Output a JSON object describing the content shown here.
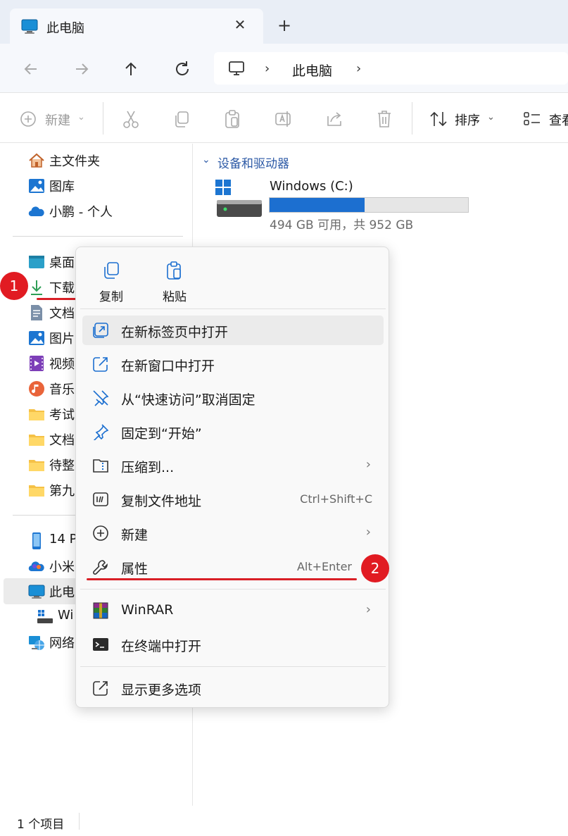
{
  "tab": {
    "title": "此电脑",
    "close_icon": "close-icon",
    "new_tab": "+"
  },
  "address": {
    "location": "此电脑"
  },
  "toolbar": {
    "new_label": "新建",
    "sort_label": "排序",
    "view_label": "查看"
  },
  "sidebar": {
    "home": "主文件夹",
    "gallery": "图库",
    "onedrive": "小鹏 - 个人",
    "desktop": "桌面",
    "downloads": "下载",
    "documents": "文档",
    "pictures": "图片",
    "videos": "视频",
    "music": "音乐",
    "folder1": "考试",
    "folder2": "文档",
    "folder3": "待整",
    "folder4": "第九",
    "phone": "14 P",
    "cloud": "小米",
    "thispc": "此电",
    "windrive": "Wi",
    "network": "网络"
  },
  "content": {
    "section": "设备和驱动器",
    "drive_name": "Windows (C:)",
    "drive_free": "494 GB 可用，共 952 GB",
    "drive_used_fraction": 0.48
  },
  "status": {
    "items": "1 个项目"
  },
  "context_menu": {
    "copy": "复制",
    "paste": "粘贴",
    "items": [
      {
        "label": "在新标签页中打开",
        "shortcut": ""
      },
      {
        "label": "在新窗口中打开",
        "shortcut": ""
      },
      {
        "label": "从“快速访问”取消固定",
        "shortcut": ""
      },
      {
        "label": "固定到“开始”",
        "shortcut": ""
      },
      {
        "label": "压缩到...",
        "shortcut": ""
      },
      {
        "label": "复制文件地址",
        "shortcut": "Ctrl+Shift+C"
      },
      {
        "label": "新建",
        "shortcut": ""
      },
      {
        "label": "属性",
        "shortcut": "Alt+Enter"
      },
      {
        "label": "WinRAR",
        "shortcut": ""
      },
      {
        "label": "在终端中打开",
        "shortcut": ""
      },
      {
        "label": "显示更多选项",
        "shortcut": ""
      }
    ]
  },
  "badges": {
    "step1": "1",
    "step2": "2"
  },
  "colors": {
    "accent": "#1c6fd0",
    "annotation": "#e11b22"
  }
}
